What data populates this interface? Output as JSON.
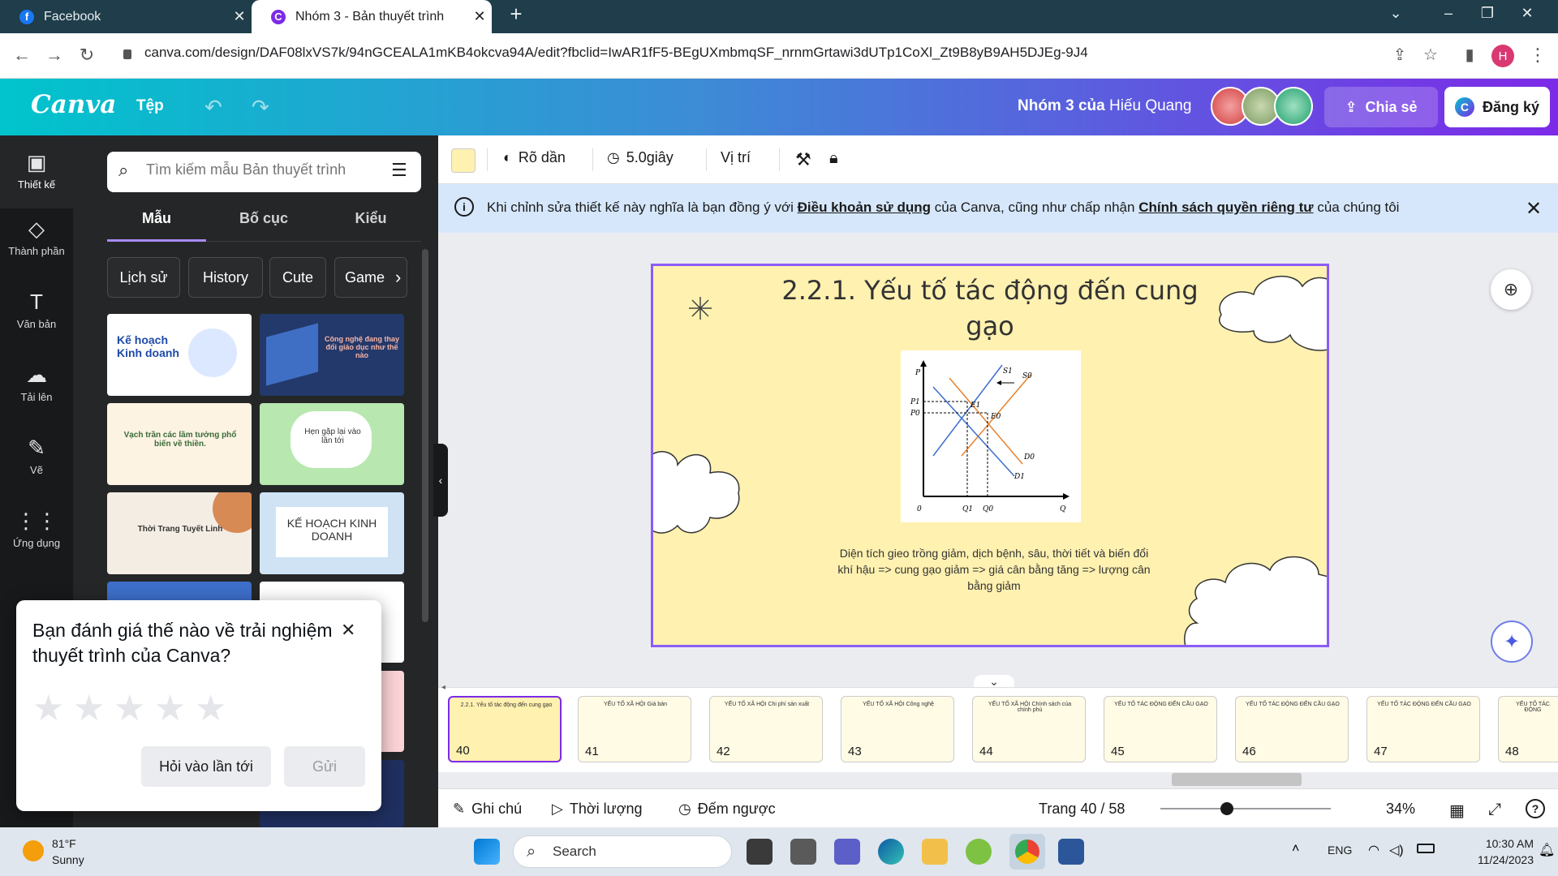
{
  "browser": {
    "tabs": [
      {
        "title": "Facebook",
        "active": false
      },
      {
        "title": "Nhóm 3 - Bản thuyết trình",
        "active": true
      }
    ],
    "url": "canva.com/design/DAF08lxVS7k/94nGCEALA1mKB4okcva94A/edit?fbclid=IwAR1fF5-BEgUXmbmqSF_nrnmGrtawi3dUTp1CoXl_Zt9B8yB9AH5DJEg-9J4",
    "profile_initial": "H"
  },
  "canva_header": {
    "logo": "Canva",
    "file_menu": "Tệp",
    "team": "Nhóm 3 của",
    "owner": "Hiếu Quang",
    "share_label": "Chia sẻ",
    "signup_label": "Đăng ký"
  },
  "rail": [
    {
      "label": "Thiết kế",
      "icon": "layout-icon"
    },
    {
      "label": "Thành phần",
      "icon": "shapes-icon"
    },
    {
      "label": "Văn bản",
      "icon": "text-icon"
    },
    {
      "label": "Tải lên",
      "icon": "upload-icon"
    },
    {
      "label": "Vẽ",
      "icon": "draw-icon"
    },
    {
      "label": "Ứng dụng",
      "icon": "apps-icon"
    }
  ],
  "panel": {
    "search_placeholder": "Tìm kiếm mẫu Bản thuyết trình",
    "tabs": [
      "Mẫu",
      "Bố cục",
      "Kiểu"
    ],
    "chips": [
      "Lịch sử",
      "History",
      "Cute",
      "Game"
    ],
    "templates": [
      {
        "title": "Kế hoạch Kinh doanh"
      },
      {
        "title": "Công nghệ đang thay đổi giáo dục như thế nào"
      },
      {
        "title": "Vạch trần các lầm tưởng phổ biến về thiền."
      },
      {
        "title": "Hẹn gặp lại vào lần tới"
      },
      {
        "title": "Thời Trang Tuyết Linh"
      },
      {
        "title": "KẾ HOẠCH KINH DOANH"
      }
    ]
  },
  "rating_popup": {
    "question": "Bạn đánh giá thế nào về trải nghiệm thuyết trình của Canva?",
    "later_label": "Hỏi vào lần tới",
    "send_label": "Gửi",
    "stars": 5
  },
  "toolbar": {
    "effect_label": "Rõ dần",
    "duration_label": "5.0giây",
    "position_label": "Vị trí",
    "color": "#fff1b0"
  },
  "notice": {
    "prefix": "Khi chỉnh sửa thiết kế này nghĩa là bạn đồng ý với",
    "terms": "Điều khoản sử dụng",
    "middle": "của Canva, cũng như chấp nhận",
    "privacy": "Chính sách quyền riêng tư",
    "suffix": "của chúng tôi"
  },
  "slide": {
    "title": "2.2.1. Yếu tố tác động đến cung gạo",
    "graph_labels": {
      "p": "P",
      "p1": "P1",
      "p0": "P0",
      "q": "Q",
      "q1": "Q1",
      "q0": "Q0",
      "origin": "0",
      "s1": "S1",
      "s0": "S0",
      "d0": "D0",
      "d1": "D1",
      "e1": "E1",
      "e0": "E0"
    },
    "caption": "Diện tích gieo trồng giảm, dịch bệnh, sâu, thời tiết và biến đổi khí hậu => cung gạo giảm => giá cân bằng tăng => lượng cân bằng giảm"
  },
  "filmstrip": [
    {
      "num": "40",
      "heading": "2.2.1. Yếu tố tác động đến cung gạo",
      "active": true
    },
    {
      "num": "41",
      "heading": "YẾU TỐ XÃ HỘI Giá bán",
      "active": false
    },
    {
      "num": "42",
      "heading": "YẾU TỐ XÃ HỘI Chi phí sản xuất",
      "active": false
    },
    {
      "num": "43",
      "heading": "YẾU TỐ XÃ HỘI Công nghệ",
      "active": false
    },
    {
      "num": "44",
      "heading": "YẾU TỐ XÃ HỘI Chính sách của chính phủ",
      "active": false
    },
    {
      "num": "45",
      "heading": "YẾU TỐ TÁC ĐỘNG ĐẾN CẦU GẠO",
      "active": false
    },
    {
      "num": "46",
      "heading": "YẾU TỐ TÁC ĐỘNG ĐẾN CẦU GẠO",
      "active": false
    },
    {
      "num": "47",
      "heading": "YẾU TỐ TÁC ĐỘNG ĐẾN CẦU GẠO",
      "active": false
    },
    {
      "num": "48",
      "heading": "YẾU TỐ TÁC ĐỘNG",
      "active": false
    }
  ],
  "footer": {
    "notes_label": "Ghi chú",
    "duration_label": "Thời lượng",
    "timer_label": "Đếm ngược",
    "page_label": "Trang 40 / 58",
    "zoom_label": "34%"
  },
  "taskbar": {
    "temp": "81°F",
    "weather": "Sunny",
    "search_label": "Search",
    "lang": "ENG",
    "time": "10:30 AM",
    "date": "11/24/2023"
  }
}
